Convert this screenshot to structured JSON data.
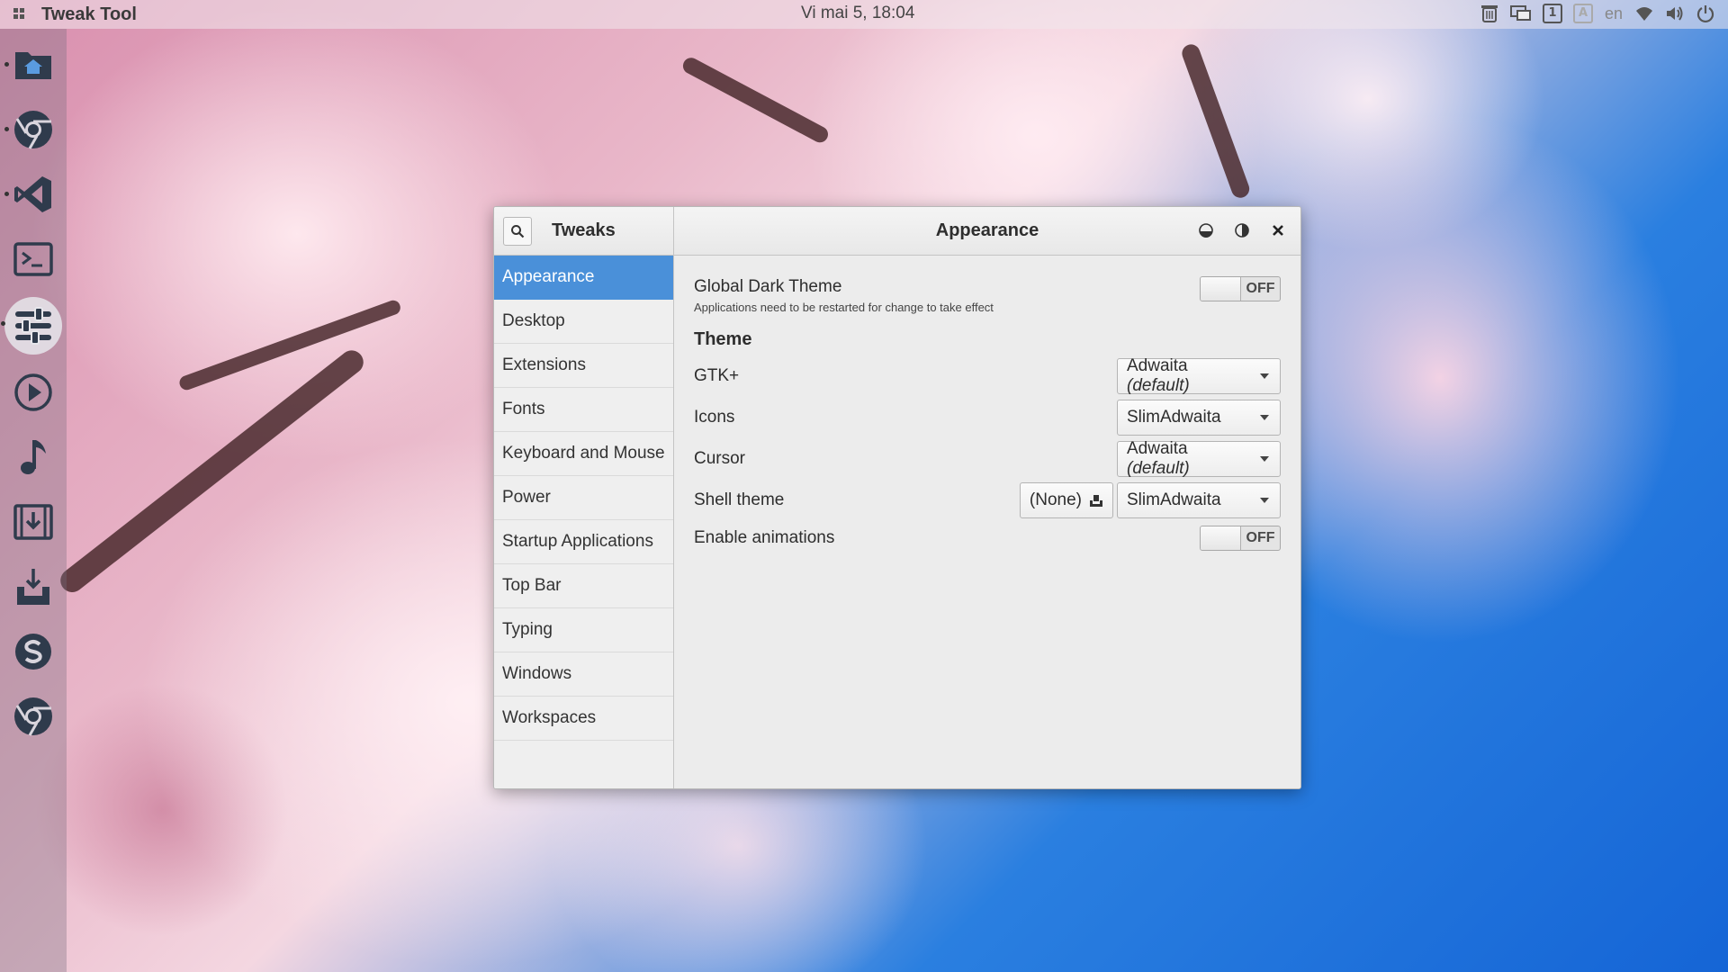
{
  "topbar": {
    "app_title": "Tweak Tool",
    "clock": "Vi mai  5, 18:04",
    "keyboard_layout": "en",
    "workspace_number": "1",
    "input_method_label": "A"
  },
  "dock": {
    "items": [
      "home-folder",
      "chrome",
      "visual-studio-code",
      "terminal",
      "tweak-tool",
      "video-player",
      "music-player",
      "downloader",
      "install-app",
      "skype",
      "chromium"
    ]
  },
  "window": {
    "sidebar_title": "Tweaks",
    "page_title": "Appearance",
    "sidebar": {
      "items": [
        {
          "label": "Appearance",
          "selected": true
        },
        {
          "label": "Desktop"
        },
        {
          "label": "Extensions"
        },
        {
          "label": "Fonts"
        },
        {
          "label": "Keyboard and Mouse"
        },
        {
          "label": "Power"
        },
        {
          "label": "Startup Applications"
        },
        {
          "label": "Top Bar"
        },
        {
          "label": "Typing"
        },
        {
          "label": "Windows"
        },
        {
          "label": "Workspaces"
        }
      ]
    },
    "appearance": {
      "dark_theme": {
        "label": "Global Dark Theme",
        "note": "Applications need to be restarted for change to take effect",
        "state": "OFF"
      },
      "theme_header": "Theme",
      "gtk": {
        "label": "GTK+",
        "value_name": "Adwaita",
        "value_suffix": "(default)"
      },
      "icons": {
        "label": "Icons",
        "value": "SlimAdwaita"
      },
      "cursor": {
        "label": "Cursor",
        "value_name": "Adwaita",
        "value_suffix": "(default)"
      },
      "shell_theme": {
        "label": "Shell theme",
        "file_value": "(None)",
        "value": "SlimAdwaita"
      },
      "animations": {
        "label": "Enable animations",
        "state": "OFF"
      }
    }
  },
  "colors": {
    "selection_blue": "#4a90d9",
    "window_bg": "#ededed"
  }
}
